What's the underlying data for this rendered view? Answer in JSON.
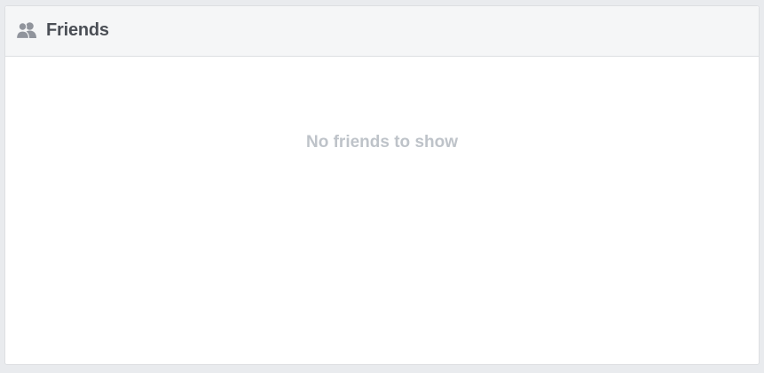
{
  "friends_panel": {
    "title": "Friends",
    "icon": "friends-icon",
    "empty_message": "No friends to show"
  },
  "colors": {
    "page_background": "#e9ebee",
    "header_background": "#f5f6f7",
    "border": "#dddfe2",
    "title_text": "#4b4f56",
    "icon": "#90949c",
    "empty_text": "#bec3c9"
  }
}
